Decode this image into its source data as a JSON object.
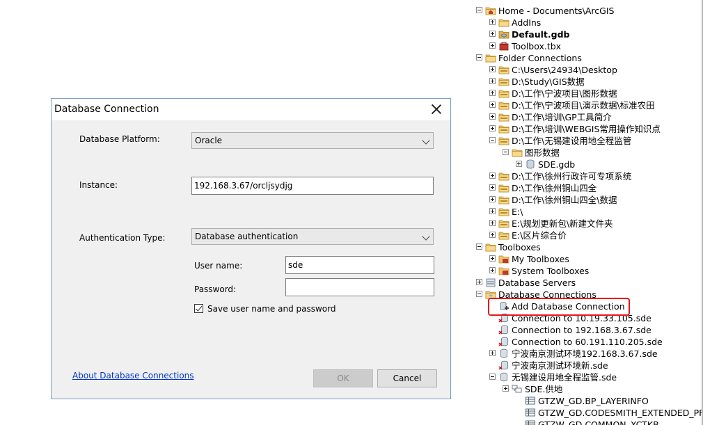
{
  "dialog": {
    "title": "Database Connection",
    "platform_label": "Database Platform:",
    "platform_value": "Oracle",
    "instance_label": "Instance:",
    "instance_value": "192.168.3.67/orcljsydjg",
    "auth_label": "Authentication Type:",
    "auth_value": "Database authentication",
    "username_label": "User name:",
    "username_value": "sde",
    "password_label": "Password:",
    "password_value": "",
    "save_label": "Save user name and password",
    "save_checked": true,
    "about_link": "About Database Connections",
    "ok_label": "OK",
    "cancel_label": "Cancel"
  },
  "catalog": {
    "items": [
      {
        "label": "Home - Documents\\ArcGIS",
        "icon": "home-folder-icon",
        "expander": "minus"
      },
      {
        "label": "AddIns",
        "icon": "folder-icon",
        "expander": "plus"
      },
      {
        "label": "Default.gdb",
        "icon": "geodatabase-icon",
        "expander": "plus"
      },
      {
        "label": "Toolbox.tbx",
        "icon": "toolbox-icon",
        "expander": "plus"
      },
      {
        "label": "Folder Connections",
        "icon": "folder-connections-icon",
        "expander": "minus"
      },
      {
        "label": "C:\\Users\\24934\\Desktop",
        "icon": "folder-connection-icon",
        "expander": "plus"
      },
      {
        "label": "D:\\Study\\GIS数据",
        "icon": "folder-connection-icon",
        "expander": "plus"
      },
      {
        "label": "D:\\工作\\宁波项目\\图形数据",
        "icon": "folder-connection-icon",
        "expander": "plus"
      },
      {
        "label": "D:\\工作\\宁波项目\\演示数据\\标准农田",
        "icon": "folder-connection-icon",
        "expander": "plus"
      },
      {
        "label": "D:\\工作\\培训\\GP工具简介",
        "icon": "folder-connection-icon",
        "expander": "plus"
      },
      {
        "label": "D:\\工作\\培训\\WEBGIS常用操作知识点",
        "icon": "folder-connection-icon",
        "expander": "plus"
      },
      {
        "label": "D:\\工作\\无锡建设用地全程监管",
        "icon": "folder-connection-icon",
        "expander": "minus"
      },
      {
        "label": "图形数据",
        "icon": "folder-icon",
        "expander": "minus"
      },
      {
        "label": "SDE.gdb",
        "icon": "sde-database-icon",
        "expander": "plus"
      },
      {
        "label": "D:\\工作\\徐州行政许可专项系统",
        "icon": "folder-connection-icon",
        "expander": "plus"
      },
      {
        "label": "D:\\工作\\徐州铜山四全",
        "icon": "folder-connection-icon",
        "expander": "plus"
      },
      {
        "label": "D:\\工作\\徐州铜山四全\\数据",
        "icon": "folder-connection-icon",
        "expander": "plus"
      },
      {
        "label": "E:\\",
        "icon": "folder-connection-icon",
        "expander": "plus"
      },
      {
        "label": "E:\\规划更新包\\新建文件夹",
        "icon": "folder-connection-icon",
        "expander": "plus"
      },
      {
        "label": "E:\\区片综合价",
        "icon": "folder-connection-icon",
        "expander": "plus"
      },
      {
        "label": "Toolboxes",
        "icon": "toolboxes-folder-icon",
        "expander": "minus"
      },
      {
        "label": "My Toolboxes",
        "icon": "my-toolboxes-icon",
        "expander": "plus"
      },
      {
        "label": "System Toolboxes",
        "icon": "system-toolboxes-icon",
        "expander": "plus"
      },
      {
        "label": "Database Servers",
        "icon": "database-servers-icon",
        "expander": "plus"
      },
      {
        "label": "Database Connections",
        "icon": "database-connections-icon",
        "expander": "minus"
      },
      {
        "label": "Add Database Connection",
        "icon": "add-database-connection-icon",
        "expander": "none"
      },
      {
        "label": "Connection to 10.19.33.105.sde",
        "icon": "sde-connection-broken-icon",
        "expander": "none"
      },
      {
        "label": "Connection to 192.168.3.67.sde",
        "icon": "sde-connection-broken-icon",
        "expander": "none"
      },
      {
        "label": "Connection to 60.191.110.205.sde",
        "icon": "sde-connection-broken-icon",
        "expander": "none"
      },
      {
        "label": "宁波南京测试环境192.168.3.67.sde",
        "icon": "sde-connection-icon",
        "expander": "plus"
      },
      {
        "label": "宁波南京测试环境新.sde",
        "icon": "sde-connection-broken-icon",
        "expander": "none"
      },
      {
        "label": "无锡建设用地全程监管.sde",
        "icon": "sde-connection-icon",
        "expander": "minus"
      },
      {
        "label": "SDE.供地",
        "icon": "feature-dataset-icon",
        "expander": "plus"
      },
      {
        "label": "GTZW_GD.BP_LAYERINFO",
        "icon": "table-icon",
        "expander": "none"
      },
      {
        "label": "GTZW_GD.CODESMITH_EXTENDED_PROPERTIES",
        "icon": "table-icon",
        "expander": "none"
      },
      {
        "label": "GTZW_GD.COMMON_XCTKB",
        "icon": "table-icon",
        "expander": "none"
      }
    ]
  },
  "colors": {
    "highlight": "#e8151b",
    "link": "#0033cc",
    "dialog_border": "#7a9cc6"
  }
}
